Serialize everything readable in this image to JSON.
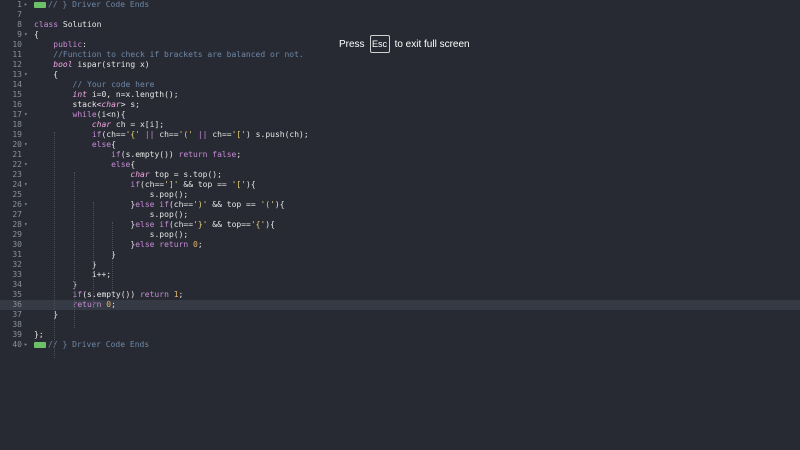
{
  "overlay": {
    "press": "Press",
    "key": "Esc",
    "suffix": "to exit full screen"
  },
  "colors": {
    "background": "#272a32",
    "current_line": "#363a44",
    "fold_marker": "#6cc06a"
  },
  "current_line": 36,
  "lines": [
    {
      "n": "1",
      "fold": "fold-collapsed",
      "indent": 0,
      "tokens": [
        [
          "marker",
          ""
        ],
        [
          "cm",
          "// } Driver Code Ends"
        ]
      ]
    },
    {
      "n": "7",
      "fold": "",
      "indent": 0,
      "tokens": []
    },
    {
      "n": "8",
      "fold": "",
      "indent": 0,
      "tokens": [
        [
          "kw",
          "class"
        ],
        [
          "op",
          " Solution"
        ]
      ]
    },
    {
      "n": "9",
      "fold": "fold-open",
      "indent": 0,
      "tokens": [
        [
          "op",
          "{"
        ]
      ]
    },
    {
      "n": "10",
      "fold": "",
      "indent": 4,
      "tokens": [
        [
          "kw",
          "public"
        ],
        [
          "op",
          ":"
        ]
      ]
    },
    {
      "n": "11",
      "fold": "",
      "indent": 4,
      "tokens": [
        [
          "cm",
          "//Function to check if brackets are balanced or not."
        ]
      ]
    },
    {
      "n": "12",
      "fold": "",
      "indent": 4,
      "tokens": [
        [
          "typ",
          "bool"
        ],
        [
          "op",
          " ispar(string x)"
        ]
      ]
    },
    {
      "n": "13",
      "fold": "fold-open",
      "indent": 4,
      "tokens": [
        [
          "op",
          "{"
        ]
      ]
    },
    {
      "n": "14",
      "fold": "",
      "indent": 8,
      "tokens": [
        [
          "cm",
          "// Your code here"
        ]
      ]
    },
    {
      "n": "15",
      "fold": "",
      "indent": 8,
      "tokens": [
        [
          "typ",
          "int"
        ],
        [
          "op",
          " i=0, n=x.length();"
        ]
      ]
    },
    {
      "n": "16",
      "fold": "",
      "indent": 8,
      "tokens": [
        [
          "op",
          "stack<"
        ],
        [
          "typ",
          "char"
        ],
        [
          "op",
          "> s;"
        ]
      ]
    },
    {
      "n": "17",
      "fold": "fold-open",
      "indent": 8,
      "tokens": [
        [
          "kw",
          "while"
        ],
        [
          "op",
          "(i<n){"
        ]
      ]
    },
    {
      "n": "18",
      "fold": "",
      "indent": 12,
      "tokens": [
        [
          "typ",
          "char"
        ],
        [
          "op",
          " ch = x[i];"
        ]
      ]
    },
    {
      "n": "19",
      "fold": "",
      "indent": 12,
      "tokens": [
        [
          "kw",
          "if"
        ],
        [
          "op",
          "(ch=="
        ],
        [
          "str",
          "'{'"
        ],
        [
          "op",
          " "
        ],
        [
          "kw",
          "||"
        ],
        [
          "op",
          " ch=="
        ],
        [
          "str",
          "'('"
        ],
        [
          "op",
          " "
        ],
        [
          "kw",
          "||"
        ],
        [
          "op",
          " ch=="
        ],
        [
          "str",
          "'['"
        ],
        [
          "op",
          ") s.push(ch);"
        ]
      ]
    },
    {
      "n": "20",
      "fold": "fold-open",
      "indent": 12,
      "tokens": [
        [
          "kw",
          "else"
        ],
        [
          "op",
          "{"
        ]
      ]
    },
    {
      "n": "21",
      "fold": "",
      "indent": 16,
      "tokens": [
        [
          "kw",
          "if"
        ],
        [
          "op",
          "(s.empty()) "
        ],
        [
          "kw",
          "return"
        ],
        [
          "op",
          " "
        ],
        [
          "kw",
          "false"
        ],
        [
          "op",
          ";"
        ]
      ]
    },
    {
      "n": "22",
      "fold": "fold-open",
      "indent": 16,
      "tokens": [
        [
          "kw",
          "else"
        ],
        [
          "op",
          "{"
        ]
      ]
    },
    {
      "n": "23",
      "fold": "",
      "indent": 20,
      "tokens": [
        [
          "typ",
          "char"
        ],
        [
          "op",
          " top = s.top();"
        ]
      ]
    },
    {
      "n": "24",
      "fold": "fold-open",
      "indent": 20,
      "tokens": [
        [
          "kw",
          "if"
        ],
        [
          "op",
          "(ch=="
        ],
        [
          "str",
          "']'"
        ],
        [
          "op",
          " && top == "
        ],
        [
          "str",
          "'['"
        ],
        [
          "op",
          "){"
        ]
      ]
    },
    {
      "n": "25",
      "fold": "",
      "indent": 24,
      "tokens": [
        [
          "op",
          "s.pop();"
        ]
      ]
    },
    {
      "n": "26",
      "fold": "fold-open",
      "indent": 20,
      "tokens": [
        [
          "op",
          "}"
        ],
        [
          "kw",
          "else if"
        ],
        [
          "op",
          "(ch=="
        ],
        [
          "str",
          "')'"
        ],
        [
          "op",
          " && top == "
        ],
        [
          "str",
          "'('"
        ],
        [
          "op",
          "){"
        ]
      ]
    },
    {
      "n": "27",
      "fold": "",
      "indent": 24,
      "tokens": [
        [
          "op",
          "s.pop();"
        ]
      ]
    },
    {
      "n": "28",
      "fold": "fold-open",
      "indent": 20,
      "tokens": [
        [
          "op",
          "}"
        ],
        [
          "kw",
          "else if"
        ],
        [
          "op",
          "(ch=="
        ],
        [
          "str",
          "'}'"
        ],
        [
          "op",
          " && top=="
        ],
        [
          "str",
          "'{'"
        ],
        [
          "op",
          "){"
        ]
      ]
    },
    {
      "n": "29",
      "fold": "",
      "indent": 24,
      "tokens": [
        [
          "op",
          "s.pop();"
        ]
      ]
    },
    {
      "n": "30",
      "fold": "",
      "indent": 20,
      "tokens": [
        [
          "op",
          "}"
        ],
        [
          "kw",
          "else return"
        ],
        [
          "op",
          " "
        ],
        [
          "num",
          "0"
        ],
        [
          "op",
          ";"
        ]
      ]
    },
    {
      "n": "31",
      "fold": "",
      "indent": 16,
      "tokens": [
        [
          "op",
          "}"
        ]
      ]
    },
    {
      "n": "32",
      "fold": "",
      "indent": 12,
      "tokens": [
        [
          "op",
          "}"
        ]
      ]
    },
    {
      "n": "33",
      "fold": "",
      "indent": 12,
      "tokens": [
        [
          "op",
          "i++;"
        ]
      ]
    },
    {
      "n": "34",
      "fold": "",
      "indent": 8,
      "tokens": [
        [
          "op",
          "}"
        ]
      ]
    },
    {
      "n": "35",
      "fold": "",
      "indent": 8,
      "tokens": [
        [
          "kw",
          "if"
        ],
        [
          "op",
          "(s.empty()) "
        ],
        [
          "kw",
          "return"
        ],
        [
          "op",
          " "
        ],
        [
          "num",
          "1"
        ],
        [
          "op",
          ";"
        ]
      ]
    },
    {
      "n": "36",
      "fold": "",
      "indent": 8,
      "tokens": [
        [
          "kw",
          "return"
        ],
        [
          "op",
          " "
        ],
        [
          "num",
          "0"
        ],
        [
          "op",
          ";"
        ]
      ]
    },
    {
      "n": "37",
      "fold": "",
      "indent": 4,
      "tokens": [
        [
          "op",
          "}"
        ]
      ]
    },
    {
      "n": "38",
      "fold": "",
      "indent": 0,
      "tokens": []
    },
    {
      "n": "39",
      "fold": "",
      "indent": 0,
      "tokens": [
        [
          "op",
          "};"
        ]
      ]
    },
    {
      "n": "40",
      "fold": "fold-collapsed",
      "indent": 0,
      "tokens": [
        [
          "marker",
          ""
        ],
        [
          "cm",
          "// } Driver Code Ends"
        ]
      ]
    }
  ]
}
